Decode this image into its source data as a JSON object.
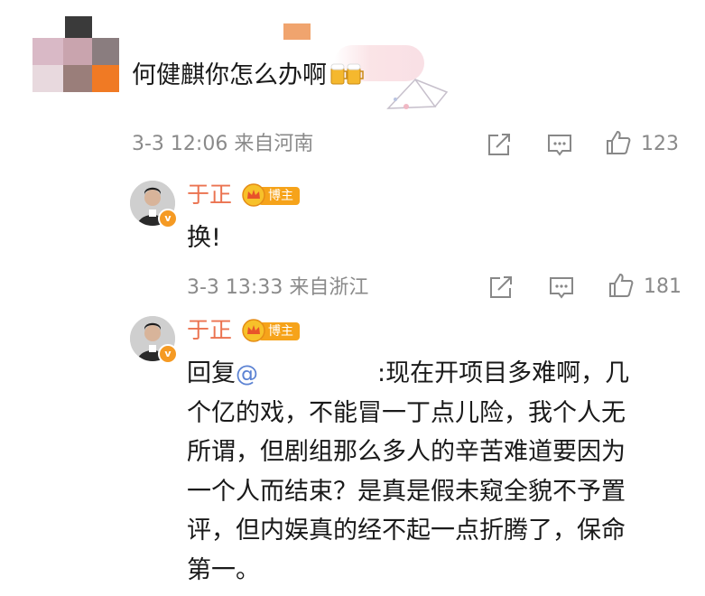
{
  "top_comment": {
    "text": "何健麒你怎么办啊",
    "timestamp": "3-3 12:06",
    "location": "来自河南",
    "like_count": "123",
    "icons": [
      "share-icon",
      "comment-icon",
      "like-icon",
      "beer-emoji-icon"
    ]
  },
  "replies": [
    {
      "username": "于正",
      "badge": "博主",
      "text": "换!",
      "timestamp": "3-3 13:33",
      "location": "来自浙江",
      "like_count": "181"
    },
    {
      "username": "于正",
      "badge": "博主",
      "reply_prefix": "回复",
      "mention_symbol": "@",
      "lines": [
        ":现在开项目多难啊，几",
        "个亿的戏，不能冒一丁点儿险，我个人无",
        "所谓，但剧组那么多人的辛苦难道要因为",
        "一个人而结束？是真是假未窥全貌不予置",
        "评，但内娱真的经不起一点折腾了，保命",
        "第一。"
      ]
    }
  ],
  "colors": {
    "username": "#eb7350",
    "meta_gray": "#8a8a8a",
    "badge_orange": "#f6a31a",
    "mention_blue": "#5b82d3"
  }
}
